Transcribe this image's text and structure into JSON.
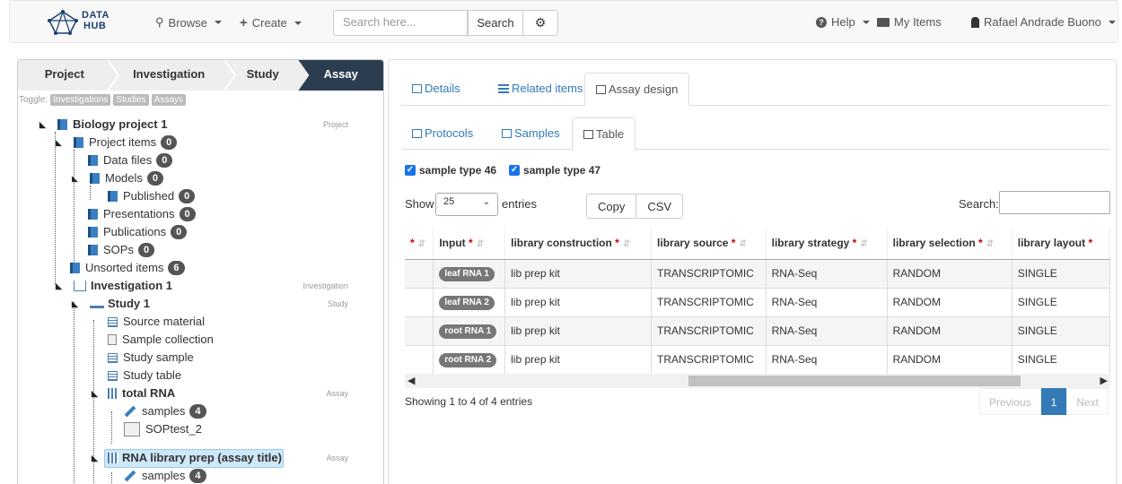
{
  "navbar": {
    "logo_text_1": "DATA",
    "logo_text_2": "HUB",
    "browse": "Browse",
    "create": "Create",
    "search_placeholder": "Search here...",
    "search_button": "Search",
    "help": "Help",
    "my_items": "My Items",
    "user": "Rafael Andrade Buono"
  },
  "breadcrumbs": [
    "Project",
    "Investigation",
    "Study",
    "Assay"
  ],
  "toggle": {
    "label": "Toggle:",
    "buttons": [
      "Investigations",
      "Studies",
      "Assays"
    ]
  },
  "tree": {
    "project": {
      "label": "Biology project 1",
      "type": "Project"
    },
    "project_items": {
      "label": "Project items",
      "count": "0"
    },
    "data_files": {
      "label": "Data files",
      "count": "0"
    },
    "models": {
      "label": "Models",
      "count": "0"
    },
    "published": {
      "label": "Published",
      "count": "0"
    },
    "presentations": {
      "label": "Presentations",
      "count": "0"
    },
    "publications": {
      "label": "Publications",
      "count": "0"
    },
    "sops": {
      "label": "SOPs",
      "count": "0"
    },
    "unsorted": {
      "label": "Unsorted items",
      "count": "6"
    },
    "investigation": {
      "label": "Investigation 1",
      "type": "Investigation"
    },
    "study": {
      "label": "Study 1",
      "type": "Study"
    },
    "source_material": "Source material",
    "sample_collection": "Sample collection",
    "study_sample": "Study sample",
    "study_table": "Study table",
    "total_rna": {
      "label": "total RNA",
      "type": "Assay"
    },
    "samples_1": {
      "label": "samples",
      "count": "4"
    },
    "soptest": "SOPtest_2",
    "rna_lib": {
      "label": "RNA library prep (assay title)",
      "type": "Assay"
    },
    "samples_2": {
      "label": "samples",
      "count": "4"
    }
  },
  "tabs": {
    "details": "Details",
    "related": "Related items",
    "assay_design": "Assay design",
    "protocols": "Protocols",
    "samples": "Samples",
    "table": "Table"
  },
  "checkboxes": [
    "sample type 46",
    "sample type 47"
  ],
  "table_controls": {
    "show": "Show",
    "entries_value": "25",
    "entries": "entries",
    "copy": "Copy",
    "csv": "CSV",
    "search_label": "Search:"
  },
  "table": {
    "headers": [
      "Input",
      "library construction",
      "library source",
      "library strategy",
      "library selection",
      "library layout"
    ],
    "rows": [
      [
        "leaf RNA 1",
        "lib prep kit",
        "TRANSCRIPTOMIC",
        "RNA-Seq",
        "RANDOM",
        "SINGLE"
      ],
      [
        "leaf RNA 2",
        "lib prep kit",
        "TRANSCRIPTOMIC",
        "RNA-Seq",
        "RANDOM",
        "SINGLE"
      ],
      [
        "root RNA 1",
        "lib prep kit",
        "TRANSCRIPTOMIC",
        "RNA-Seq",
        "RANDOM",
        "SINGLE"
      ],
      [
        "root RNA 2",
        "lib prep kit",
        "TRANSCRIPTOMIC",
        "RNA-Seq",
        "RANDOM",
        "SINGLE"
      ]
    ]
  },
  "footer": {
    "info": "Showing 1 to 4 of 4 entries",
    "previous": "Previous",
    "page": "1",
    "next": "Next"
  }
}
